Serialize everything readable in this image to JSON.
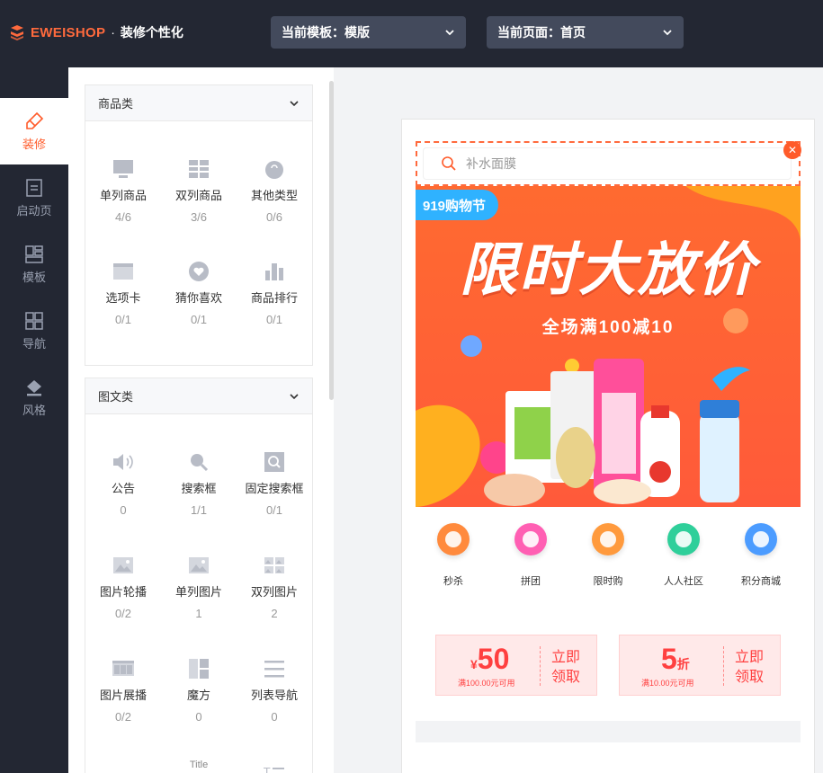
{
  "brand": {
    "name": "EWEISHOP",
    "dot": "·",
    "subtitle": "装修个性化"
  },
  "header": {
    "template_select": "当前模板：模版",
    "page_select": "当前页面：首页"
  },
  "leftnav": [
    {
      "label": "装修",
      "icon": "brush-icon",
      "active": true
    },
    {
      "label": "启动页",
      "icon": "document-icon",
      "active": false
    },
    {
      "label": "模板",
      "icon": "template-icon",
      "active": false
    },
    {
      "label": "导航",
      "icon": "grid-icon",
      "active": false
    },
    {
      "label": "风格",
      "icon": "paint-bucket-icon",
      "active": false
    }
  ],
  "sections": [
    {
      "title": "商品类",
      "items": [
        {
          "label": "单列商品",
          "count": "4/6",
          "icon": "monitor-icon"
        },
        {
          "label": "双列商品",
          "count": "3/6",
          "icon": "grid-two-icon"
        },
        {
          "label": "其他类型",
          "count": "0/6",
          "icon": "bag-icon"
        },
        {
          "label": "选项卡",
          "count": "0/1",
          "icon": "tab-card-icon"
        },
        {
          "label": "猜你喜欢",
          "count": "0/1",
          "icon": "heart-icon"
        },
        {
          "label": "商品排行",
          "count": "0/1",
          "icon": "bar-rank-icon"
        }
      ]
    },
    {
      "title": "图文类",
      "items": [
        {
          "label": "公告",
          "count": "0",
          "icon": "speaker-icon"
        },
        {
          "label": "搜索框",
          "count": "1/1",
          "icon": "search-icon"
        },
        {
          "label": "固定搜索框",
          "count": "0/1",
          "icon": "search-box-icon"
        },
        {
          "label": "图片轮播",
          "count": "0/2",
          "icon": "image-carousel-icon"
        },
        {
          "label": "单列图片",
          "count": "1",
          "icon": "image-icon"
        },
        {
          "label": "双列图片",
          "count": "2",
          "icon": "image-grid-icon"
        },
        {
          "label": "图片展播",
          "count": "0/2",
          "icon": "image-showcase-icon"
        },
        {
          "label": "魔方",
          "count": "0",
          "icon": "cube-icon"
        },
        {
          "label": "列表导航",
          "count": "0",
          "icon": "list-icon"
        },
        {
          "label": "Title",
          "count": "",
          "icon": "title-icon"
        }
      ]
    }
  ],
  "preview": {
    "search_placeholder": "补水面膜",
    "banner_tag": "919购物节",
    "banner_title": "限时大放价",
    "banner_sub": "全场满100减10",
    "quick_icons": [
      {
        "label": "秒杀",
        "color": "#ff8a3d"
      },
      {
        "label": "拼团",
        "color": "#ff5fb3"
      },
      {
        "label": "限时购",
        "color": "#ff9a3d"
      },
      {
        "label": "人人社区",
        "color": "#2fcf9a"
      },
      {
        "label": "积分商城",
        "color": "#4c9cff"
      }
    ],
    "coupons": [
      {
        "symbol": "¥",
        "value": "50",
        "suffix": "",
        "condition": "满100.00元可用",
        "action": "立即领取"
      },
      {
        "symbol": "",
        "value": "5",
        "suffix": "折",
        "condition": "满10.00元可用",
        "action": "立即领取"
      }
    ]
  },
  "colors": {
    "accent": "#ff5b2a",
    "topbar": "#232733",
    "dropdown": "#434a5c",
    "coupon_red": "#ff4040"
  }
}
